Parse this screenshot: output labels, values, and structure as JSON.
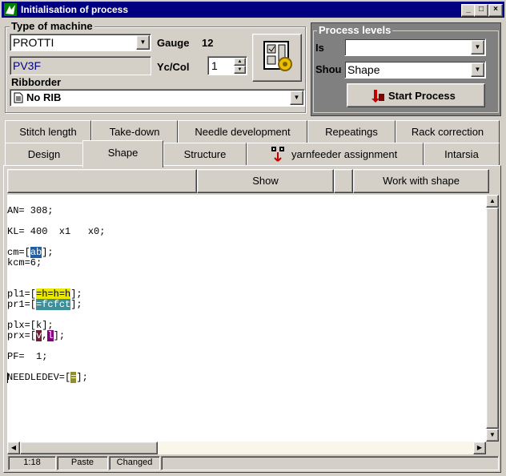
{
  "window": {
    "title": "Initialisation of process"
  },
  "machine": {
    "group_label": "Type of machine",
    "type_value": "PROTTI",
    "model": "PV3F",
    "gauge_label": "Gauge",
    "gauge_value": "12",
    "yccol_label": "Yc/Col",
    "yccol_value": "1",
    "ribborder_label": "Ribborder",
    "ribborder_value": "No RIB"
  },
  "process_levels": {
    "group_label": "Process levels",
    "is_label": "Is",
    "is_value": "",
    "shou_label": "Shou",
    "shou_value": "Shape",
    "start_label": "Start Process"
  },
  "tabs_row1": [
    "Stitch length",
    "Take-down",
    "Needle development",
    "Repeatings",
    "Rack correction"
  ],
  "tabs_row2": [
    "Design",
    "Shape",
    "Structure",
    "yarnfeeder assignment",
    "Intarsia"
  ],
  "active_tab": "Shape",
  "toolbar": {
    "show_label": "Show",
    "work_label": "Work with shape"
  },
  "code": {
    "an": "AN= 308;",
    "kl": "KL= 400  x1   x0;",
    "cm_pre": "cm=[",
    "cm_hl": "ab",
    "cm_post": "];",
    "kcm": "kcm=6;",
    "pl1_pre": "pl1=[",
    "pl1_hl": "=h=h=h",
    "pl1_post": "];",
    "pr1_pre": "pr1=[",
    "pr1_hl": "=fcfct",
    "pr1_post": "];",
    "plx": "plx=[k];",
    "prx_pre": "prx=[",
    "prx_hl1": "v",
    "prx_mid": ",",
    "prx_hl2": "l",
    "prx_post": "];",
    "pf": "PF=  1;",
    "nd_pre": "NEEDLEDEV=[",
    "nd_hl": "=",
    "nd_post": "];"
  },
  "status": {
    "position": "1:18",
    "mode": "Paste",
    "state": "Changed"
  },
  "icons": [
    "process-logo-icon",
    "machine-setup-icon",
    "yarnfeeder-icon",
    "start-process-icon",
    "document-icon"
  ]
}
